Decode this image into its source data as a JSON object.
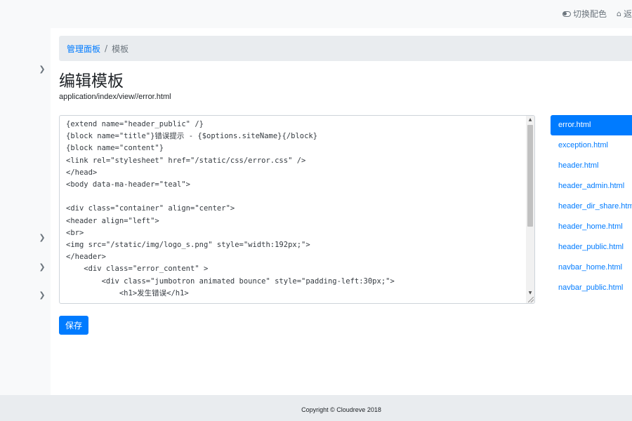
{
  "topbar": {
    "theme_toggle_label": "切换配色",
    "home_label": "返"
  },
  "breadcrumb": {
    "root": "管理面板",
    "current": "模板"
  },
  "page": {
    "title": "编辑模板",
    "path": "application/index/view//error.html"
  },
  "editor": {
    "content": "{extend name=\"header_public\" /}\n{block name=\"title\"}错误提示 - {$options.siteName}{/block}\n{block name=\"content\"}\n<link rel=\"stylesheet\" href=\"/static/css/error.css\" />\n</head>\n<body data-ma-header=\"teal\">\n\n<div class=\"container\" align=\"center\">\n<header align=\"left\">\n<br>\n<img src=\"/static/img/logo_s.png\" style=\"width:192px;\">\n</header>\n    <div class=\"error_content\" >\n        <div class=\"jumbotron animated bounce\" style=\"padding-left:30px;\">\n            <h1>发生错误</h1>"
  },
  "save_button": "保存",
  "files": [
    "error.html",
    "exception.html",
    "header.html",
    "header_admin.html",
    "header_dir_share.html",
    "header_home.html",
    "header_public.html",
    "navbar_home.html",
    "navbar_public.html"
  ],
  "active_file": "error.html",
  "footer": {
    "copyright": "Copyright © Cloudreve 2018"
  },
  "colors": {
    "primary": "#007bff",
    "breadcrumb_bg": "#e9ecef",
    "page_bg": "#f8f9fa"
  }
}
